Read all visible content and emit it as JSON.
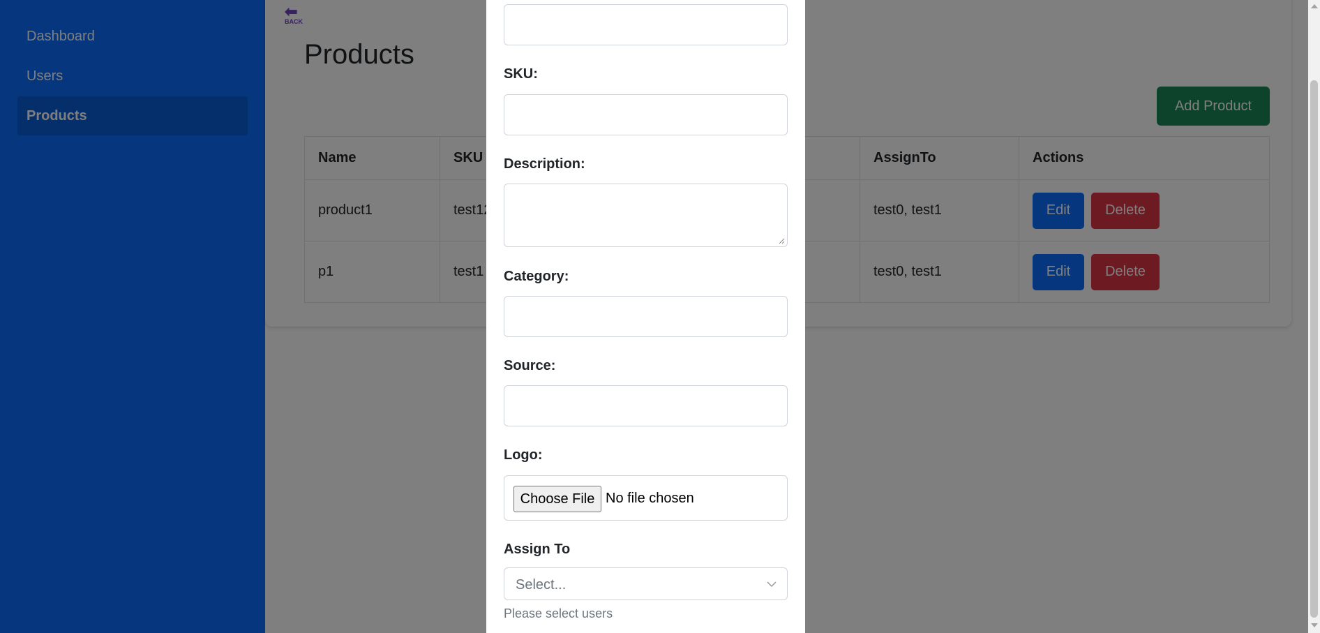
{
  "sidebar": {
    "items": [
      {
        "label": "Dashboard"
      },
      {
        "label": "Users"
      },
      {
        "label": "Products"
      }
    ]
  },
  "main": {
    "back_label": "BACK",
    "title": "Products",
    "add_button": "Add Product",
    "table": {
      "headers": [
        "Name",
        "SKU",
        "",
        "",
        "AssignTo",
        "Actions"
      ],
      "rows": [
        {
          "name": "product1",
          "sku": "test12",
          "assign_to": "test0, test1"
        },
        {
          "name": "p1",
          "sku": "test1",
          "assign_to": "test0, test1"
        }
      ],
      "edit_label": "Edit",
      "delete_label": "Delete"
    }
  },
  "modal": {
    "fields": {
      "sku": "SKU:",
      "description": "Description:",
      "category": "Category:",
      "source": "Source:",
      "logo": "Logo:",
      "assign_to": "Assign To"
    },
    "file_button": "Choose File",
    "file_status": "No file chosen",
    "select_placeholder": "Select...",
    "help_text": "Please select users"
  },
  "colors": {
    "sidebar": "#0d6efd",
    "add_button": "#198754",
    "edit_button": "#0d6efd",
    "delete_button": "#dc3545",
    "back_icon": "#6f42c1"
  },
  "icons": [
    "back-arrow-icon",
    "chevron-down-icon",
    "resize-grip-icon"
  ]
}
